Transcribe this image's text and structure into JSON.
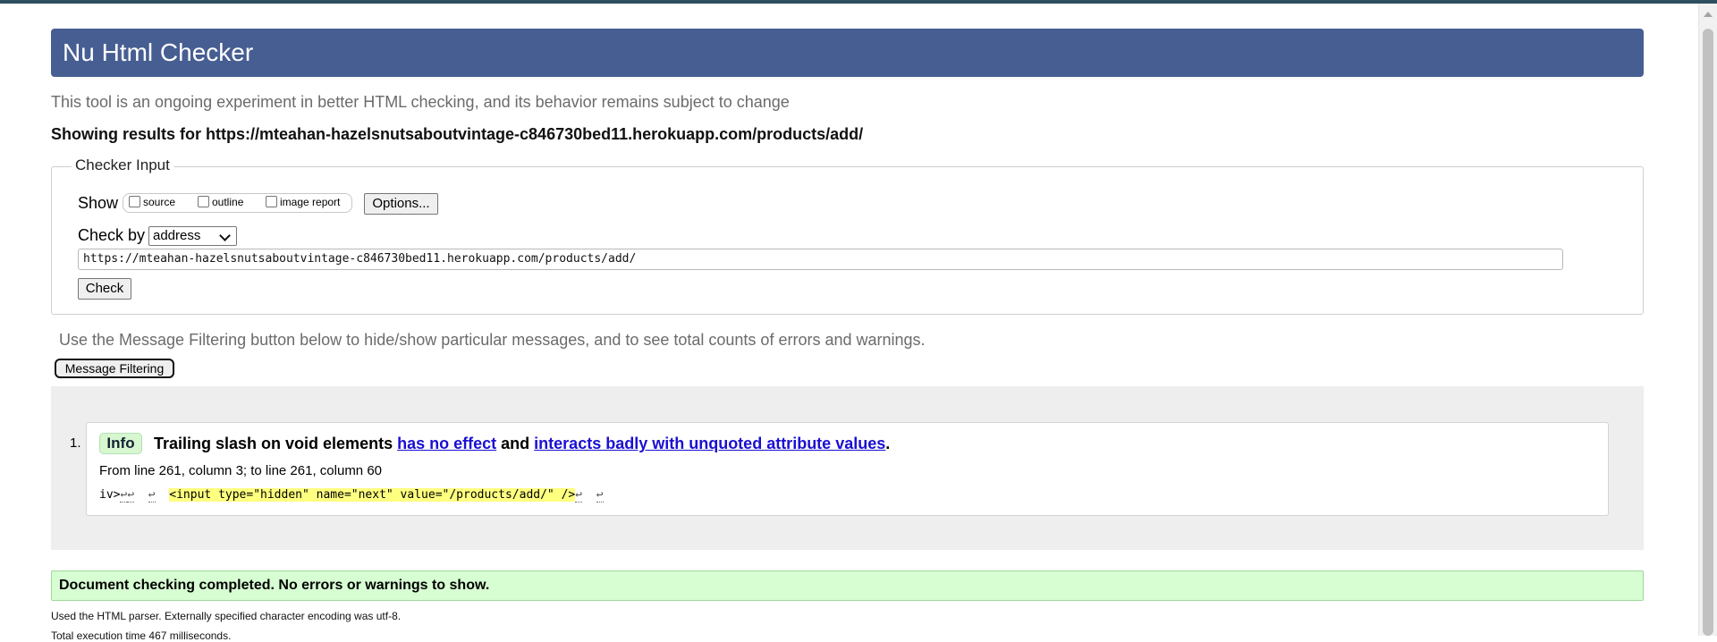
{
  "header": {
    "title": "Nu Html Checker"
  },
  "subtitle": "This tool is an ongoing experiment in better HTML checking, and its behavior remains subject to change",
  "results_heading": "Showing results for https://mteahan-hazelsnutsaboutvintage-c846730bed11.herokuapp.com/products/add/",
  "checker_input": {
    "legend": "Checker Input",
    "show_label": "Show",
    "show_options": [
      {
        "label": "source",
        "checked": false
      },
      {
        "label": "outline",
        "checked": false
      },
      {
        "label": "image report",
        "checked": false
      }
    ],
    "options_button": "Options...",
    "check_by_label": "Check by",
    "check_by_value": "address",
    "url_value": "https://mteahan-hazelsnutsaboutvintage-c846730bed11.herokuapp.com/products/add/",
    "check_button": "Check"
  },
  "filter_note": "Use the Message Filtering button below to hide/show particular messages, and to see total counts of errors and warnings.",
  "filter_button": "Message Filtering",
  "messages": [
    {
      "number": "1.",
      "type": "Info",
      "text_prefix": "Trailing slash on void elements",
      "link1": "has no effect",
      "text_middle": "and",
      "link2": "interacts badly with unquoted attribute values",
      "text_suffix": ".",
      "location": "From line 261, column 3; to line 261, column 60",
      "extract": {
        "before": "iv>",
        "highlight": "<input type=\"hidden\" name=\"next\" value=\"/products/add/\" />",
        "line_feed": "↩"
      }
    }
  ],
  "success_message": "Document checking completed. No errors or warnings to show.",
  "details": {
    "parser": "Used the HTML parser. Externally specified character encoding was utf-8.",
    "execution_time": "Total execution time 467 milliseconds."
  }
}
